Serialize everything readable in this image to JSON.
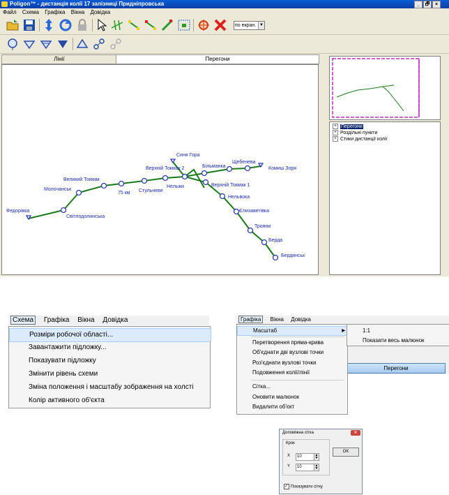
{
  "window": {
    "title": "Poligon™ - дистанція колії 17 залізниці Придніпровська",
    "controls": [
      "_",
      "🗗",
      "×"
    ]
  },
  "menubar": [
    "Файл",
    "Схема",
    "Графіка",
    "Вікна",
    "Довідка"
  ],
  "toolbar": {
    "scale_combo": "по екран."
  },
  "tabs": [
    "Лінії",
    "Перегони"
  ],
  "tree": {
    "items": [
      "Перегони",
      "Роздільні пункти",
      "Стики дистанції колії"
    ]
  },
  "map": {
    "stations": [
      "Федорівка",
      "Світлодолинська",
      "Молочанськ",
      "Великий Токмак",
      "75 км",
      "Стульневе",
      "Нельжи",
      "Верхній Токмак 2",
      "Синя Гора",
      "Більманка",
      "Щебенева",
      "Комиш Зоря",
      "Верхній Токмак 1",
      "Нельвока",
      "Єлизаветівка",
      "Трояни",
      "Берда",
      "Бердянськ"
    ]
  },
  "menu_schema": {
    "bar": [
      "Схема",
      "Графіка",
      "Вікна",
      "Довідка"
    ],
    "items": [
      "Розміри робочої області...",
      "Завантажити підложку...",
      "Показувати підложку",
      "Змінити рівень схеми",
      "Зміна положення і масштабу зображення на холсті",
      "Колір активного об'єкта"
    ]
  },
  "menu_graphics": {
    "bar": [
      "Графіка",
      "Вікна",
      "Довідка"
    ],
    "items": [
      "Масштаб",
      "Перетворення прямa-крива",
      "Об'єднати дві вузлові точки",
      "Роз'єднати вузлові точки",
      "Подовження колії/лінії",
      "Сітка...",
      "Оновити малюнок",
      "Видалити об'єкт"
    ],
    "submenu": [
      "1:1",
      "Показати весь малюнок"
    ],
    "background_tab": "Перегони"
  },
  "dialog": {
    "title": "Допоміжна сітка",
    "group_label": "Крок",
    "x_label": "X",
    "x_value": "10",
    "y_label": "Y",
    "y_value": "10",
    "ok_label": "OK",
    "checkbox_label": "Показувати сітку",
    "checkbox_checked": true
  }
}
